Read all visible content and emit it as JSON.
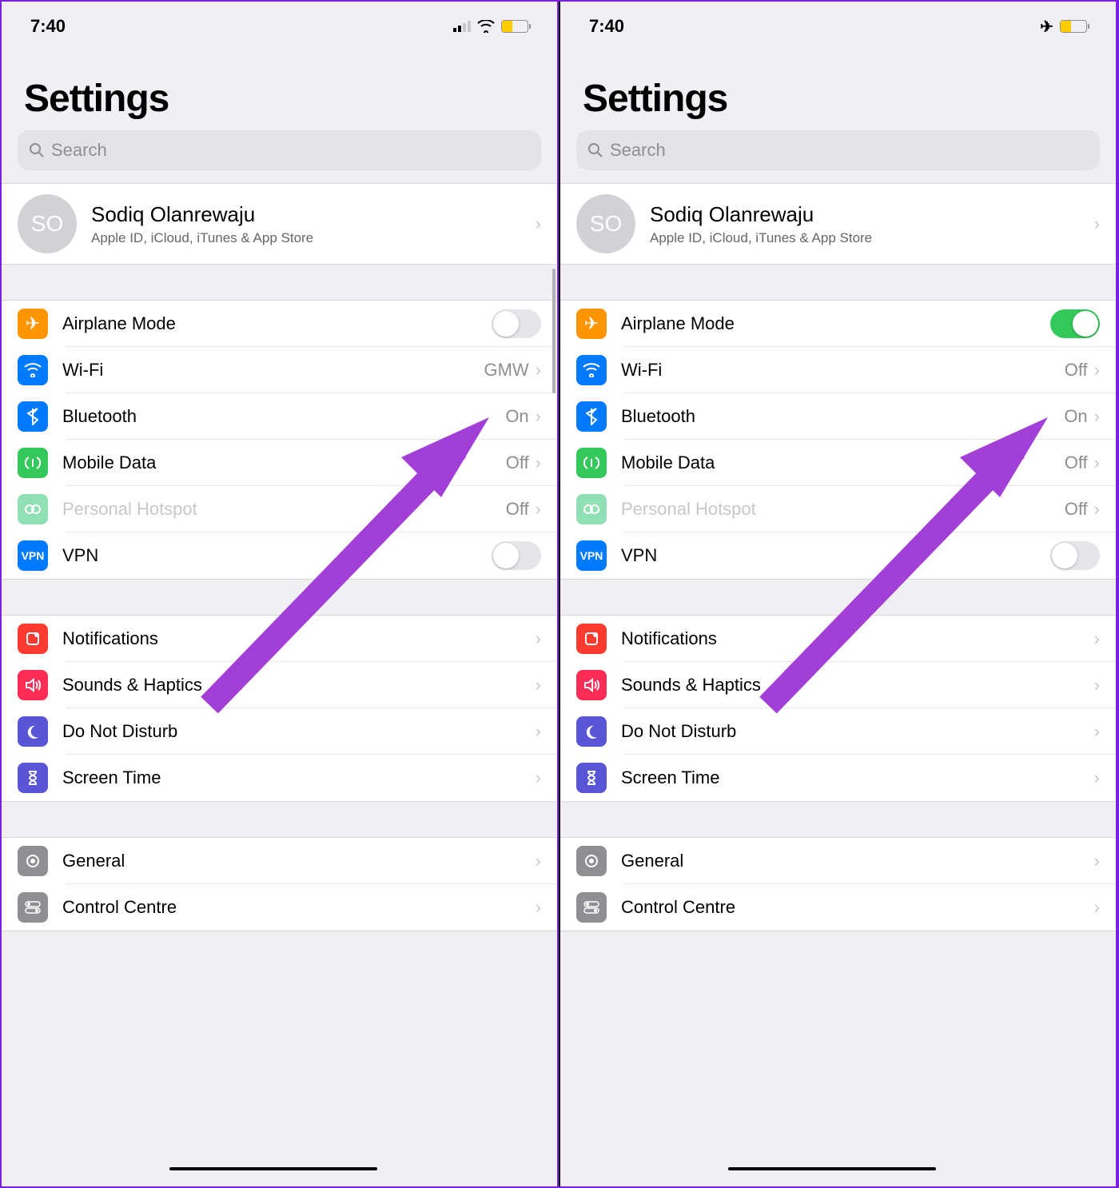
{
  "panes": [
    {
      "status": {
        "time": "7:40",
        "icons": [
          "signal",
          "wifi",
          "battery"
        ],
        "battery_pct": 40
      },
      "title": "Settings",
      "search_placeholder": "Search",
      "profile": {
        "initials": "SO",
        "name": "Sodiq Olanrewaju",
        "sub": "Apple ID, iCloud, iTunes & App Store"
      },
      "network": {
        "airplane": {
          "label": "Airplane Mode",
          "on": false,
          "color": "#ff9500"
        },
        "wifi": {
          "label": "Wi-Fi",
          "value": "GMW",
          "color": "#007aff"
        },
        "bluetooth": {
          "label": "Bluetooth",
          "value": "On",
          "color": "#007aff"
        },
        "mobile": {
          "label": "Mobile Data",
          "value": "Off",
          "color": "#34c759"
        },
        "hotspot": {
          "label": "Personal Hotspot",
          "value": "Off",
          "color": "#8fe0b4",
          "disabled": true
        },
        "vpn": {
          "label": "VPN",
          "on": false,
          "color": "#007aff"
        }
      },
      "sys": {
        "notifications": {
          "label": "Notifications",
          "color": "#ff3b30"
        },
        "sounds": {
          "label": "Sounds & Haptics",
          "color": "#ff2d55"
        },
        "dnd": {
          "label": "Do Not Disturb",
          "color": "#5856d6"
        },
        "screentime": {
          "label": "Screen Time",
          "color": "#5856d6"
        }
      },
      "general": {
        "general": {
          "label": "General",
          "color": "#8e8e93"
        },
        "control": {
          "label": "Control Centre",
          "color": "#8e8e93"
        }
      }
    },
    {
      "status": {
        "time": "7:40",
        "icons": [
          "airplane",
          "battery"
        ],
        "battery_pct": 40
      },
      "title": "Settings",
      "search_placeholder": "Search",
      "profile": {
        "initials": "SO",
        "name": "Sodiq Olanrewaju",
        "sub": "Apple ID, iCloud, iTunes & App Store"
      },
      "network": {
        "airplane": {
          "label": "Airplane Mode",
          "on": true,
          "color": "#ff9500"
        },
        "wifi": {
          "label": "Wi-Fi",
          "value": "Off",
          "color": "#007aff"
        },
        "bluetooth": {
          "label": "Bluetooth",
          "value": "On",
          "color": "#007aff"
        },
        "mobile": {
          "label": "Mobile Data",
          "value": "Off",
          "color": "#34c759"
        },
        "hotspot": {
          "label": "Personal Hotspot",
          "value": "Off",
          "color": "#8fe0b4",
          "disabled": true
        },
        "vpn": {
          "label": "VPN",
          "on": false,
          "color": "#007aff"
        }
      },
      "sys": {
        "notifications": {
          "label": "Notifications",
          "color": "#ff3b30"
        },
        "sounds": {
          "label": "Sounds & Haptics",
          "color": "#ff2d55"
        },
        "dnd": {
          "label": "Do Not Disturb",
          "color": "#5856d6"
        },
        "screentime": {
          "label": "Screen Time",
          "color": "#5856d6"
        }
      },
      "general": {
        "general": {
          "label": "General",
          "color": "#8e8e93"
        },
        "control": {
          "label": "Control Centre",
          "color": "#8e8e93"
        }
      }
    }
  ]
}
